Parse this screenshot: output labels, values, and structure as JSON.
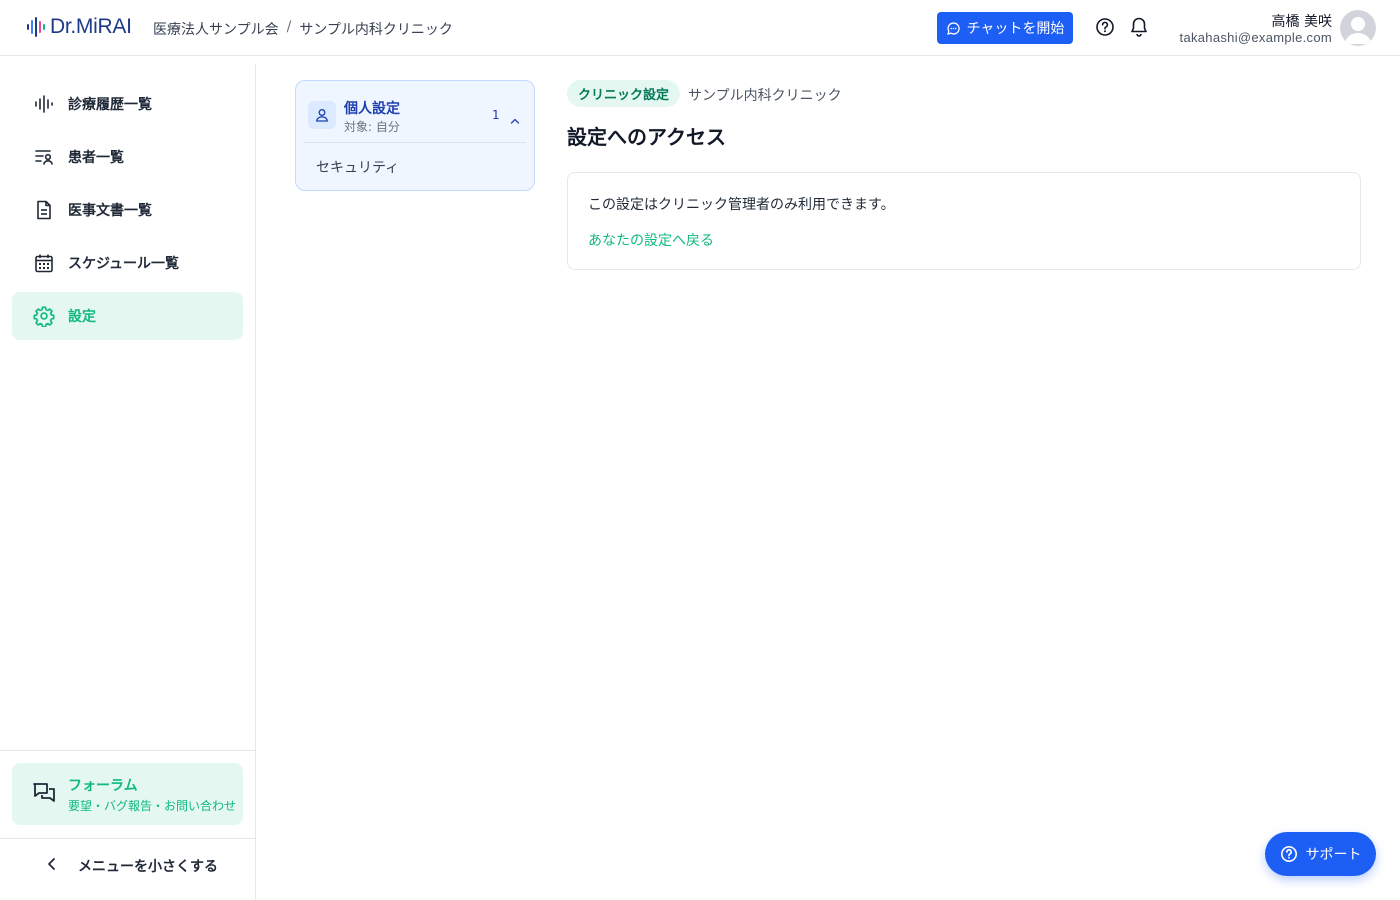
{
  "header": {
    "logo_text": "Dr.MiRAI",
    "org_name": "医療法人サンプル会",
    "separator": "/",
    "clinic_name": "サンプル内科クリニック",
    "chat_button": "チャットを開始",
    "user_name": "高橋 美咲",
    "user_email": "takahashi@example.com"
  },
  "sidebar": {
    "items": [
      {
        "label": "診療履歴一覧",
        "icon": "waveform-icon"
      },
      {
        "label": "患者一覧",
        "icon": "patient-list-icon"
      },
      {
        "label": "医事文書一覧",
        "icon": "document-icon"
      },
      {
        "label": "スケジュール一覧",
        "icon": "calendar-icon"
      },
      {
        "label": "設定",
        "icon": "gear-icon",
        "active": true
      }
    ],
    "forum": {
      "title": "フォーラム",
      "subtitle": "要望・バグ報告・お問い合わせ"
    },
    "collapse_label": "メニューを小さくする"
  },
  "settings_panel": {
    "title": "個人設定",
    "subtitle": "対象: 自分",
    "count": "1",
    "items": [
      "セキュリティ"
    ]
  },
  "main": {
    "tag": "クリニック設定",
    "tag_clinic": "サンプル内科クリニック",
    "title": "設定へのアクセス",
    "message": "この設定はクリニック管理者のみ利用できます。",
    "back_link": "あなたの設定へ戻る"
  },
  "support_button": "サポート",
  "colors": {
    "primary_blue": "#1d5ff5",
    "accent_green": "#10b981",
    "active_bg": "#e4f8f1"
  }
}
